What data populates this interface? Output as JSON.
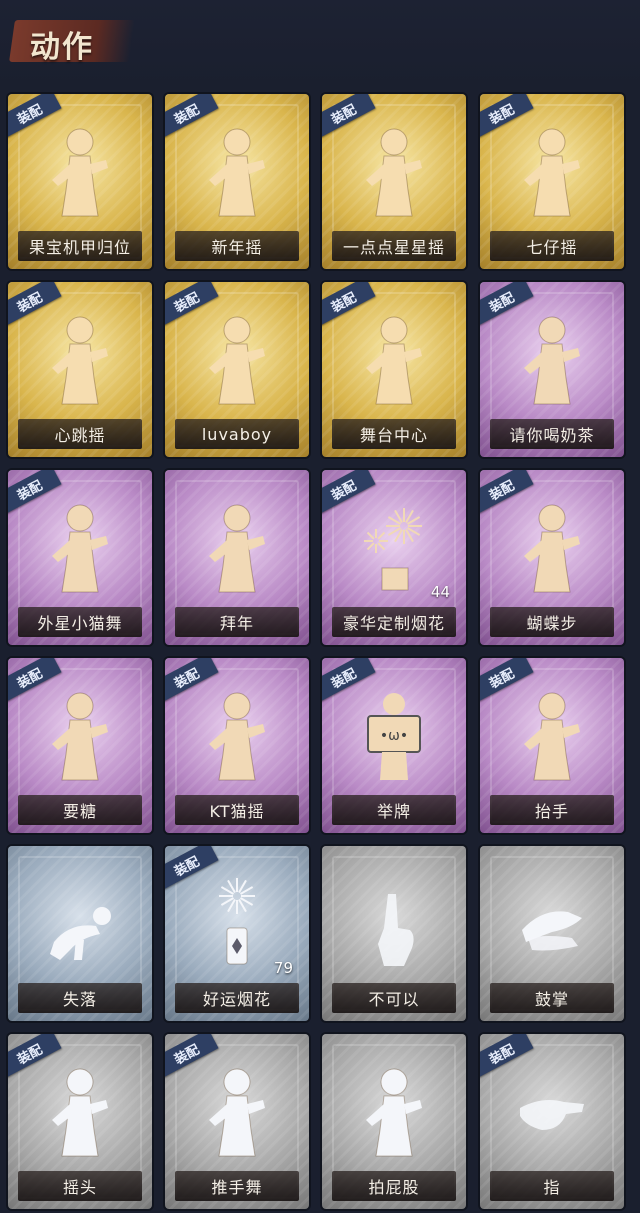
{
  "page": {
    "title": "动作"
  },
  "badge_label": "装配",
  "actions": [
    {
      "name": "果宝机甲归位",
      "rarity": "gold",
      "equipped": true,
      "icon": "figure-icon",
      "count": ""
    },
    {
      "name": "新年摇",
      "rarity": "gold",
      "equipped": true,
      "icon": "figure-icon",
      "count": ""
    },
    {
      "name": "一点点星星摇",
      "rarity": "gold",
      "equipped": true,
      "icon": "figure-icon",
      "count": ""
    },
    {
      "name": "七仔摇",
      "rarity": "gold",
      "equipped": true,
      "icon": "figure-icon",
      "count": ""
    },
    {
      "name": "心跳摇",
      "rarity": "gold",
      "equipped": true,
      "icon": "figure-icon",
      "count": ""
    },
    {
      "name": "luvaboy",
      "rarity": "gold",
      "equipped": true,
      "icon": "figure-icon",
      "count": ""
    },
    {
      "name": "舞台中心",
      "rarity": "gold",
      "equipped": true,
      "icon": "figure-icon",
      "count": ""
    },
    {
      "name": "请你喝奶茶",
      "rarity": "purple",
      "equipped": true,
      "icon": "figure-icon",
      "count": ""
    },
    {
      "name": "外星小猫舞",
      "rarity": "purple",
      "equipped": true,
      "icon": "figure-icon",
      "count": ""
    },
    {
      "name": "拜年",
      "rarity": "purple",
      "equipped": false,
      "icon": "figure-icon",
      "count": ""
    },
    {
      "name": "豪华定制烟花",
      "rarity": "purple",
      "equipped": true,
      "icon": "fireworks-icon",
      "count": "44"
    },
    {
      "name": "蝴蝶步",
      "rarity": "purple",
      "equipped": true,
      "icon": "figure-icon",
      "count": ""
    },
    {
      "name": "要糖",
      "rarity": "purple",
      "equipped": true,
      "icon": "figure-icon",
      "count": ""
    },
    {
      "name": "KT猫摇",
      "rarity": "purple",
      "equipped": true,
      "icon": "figure-icon",
      "count": ""
    },
    {
      "name": "举牌",
      "rarity": "purple",
      "equipped": true,
      "icon": "sign-icon",
      "count": ""
    },
    {
      "name": "抬手",
      "rarity": "purple",
      "equipped": true,
      "icon": "figure-icon",
      "count": ""
    },
    {
      "name": "失落",
      "rarity": "blue",
      "equipped": false,
      "icon": "crawl-icon",
      "count": ""
    },
    {
      "name": "好运烟花",
      "rarity": "blue",
      "equipped": true,
      "icon": "firecracker-icon",
      "count": "79"
    },
    {
      "name": "不可以",
      "rarity": "gray",
      "equipped": false,
      "icon": "finger-icon",
      "count": ""
    },
    {
      "name": "鼓掌",
      "rarity": "gray",
      "equipped": false,
      "icon": "clap-icon",
      "count": ""
    },
    {
      "name": "摇头",
      "rarity": "gray",
      "equipped": true,
      "icon": "figure-icon",
      "count": ""
    },
    {
      "name": "推手舞",
      "rarity": "gray",
      "equipped": true,
      "icon": "figure-icon",
      "count": ""
    },
    {
      "name": "拍屁股",
      "rarity": "gray",
      "equipped": false,
      "icon": "figure-icon",
      "count": ""
    },
    {
      "name": "指",
      "rarity": "gray",
      "equipped": true,
      "icon": "point-icon",
      "count": ""
    }
  ],
  "colors": {
    "gold": "#d9b54c",
    "purple": "#b98ac6",
    "blue": "#9aabbd",
    "gray": "#a8a8a8",
    "badge": "#2e3f63"
  }
}
